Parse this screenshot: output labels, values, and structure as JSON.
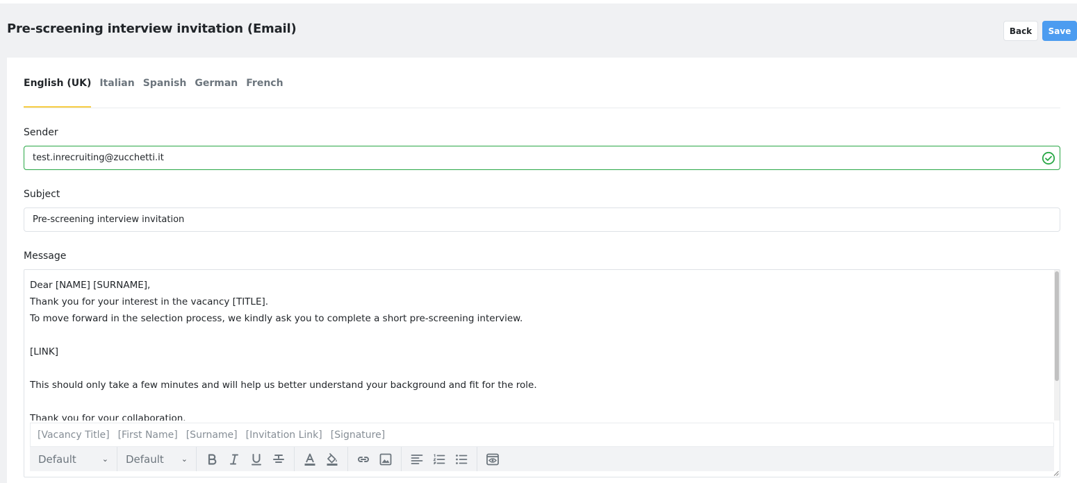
{
  "header": {
    "title": "Pre-screening interview invitation (Email)",
    "back_label": "Back",
    "save_label": "Save"
  },
  "tabs": [
    {
      "label": "English (UK)",
      "active": true
    },
    {
      "label": "Italian",
      "active": false
    },
    {
      "label": "Spanish",
      "active": false
    },
    {
      "label": "German",
      "active": false
    },
    {
      "label": "French",
      "active": false
    }
  ],
  "form": {
    "sender": {
      "label": "Sender",
      "value": "test.inrecruiting@zucchetti.it",
      "valid": true
    },
    "subject": {
      "label": "Subject",
      "value": "Pre-screening interview invitation"
    },
    "message": {
      "label": "Message",
      "lines": [
        "Dear [NAME] [SURNAME],",
        "Thank you for your interest in the vacancy [TITLE].",
        "To move forward in the selection process, we kindly ask you to complete a short pre-screening interview.",
        "",
        "[LINK]",
        "",
        "This should only take a few minutes and will help us better understand your background and fit for the role.",
        "",
        "Thank you for your collaboration."
      ]
    }
  },
  "editor": {
    "placeholders": [
      "[Vacancy Title]",
      "[First Name]",
      "[Surname]",
      "[Invitation Link]",
      "[Signature]"
    ],
    "font_select": "Default",
    "size_select": "Default",
    "icons": [
      "bold-icon",
      "italic-icon",
      "underline-icon",
      "strikethrough-icon",
      "text-color-icon",
      "fill-color-icon",
      "link-icon",
      "image-icon",
      "align-left-icon",
      "ordered-list-icon",
      "bullet-list-icon",
      "preview-icon"
    ]
  },
  "colors": {
    "accent": "#4c9cf0",
    "tab_indicator": "#f7cd42",
    "valid": "#28a745"
  }
}
